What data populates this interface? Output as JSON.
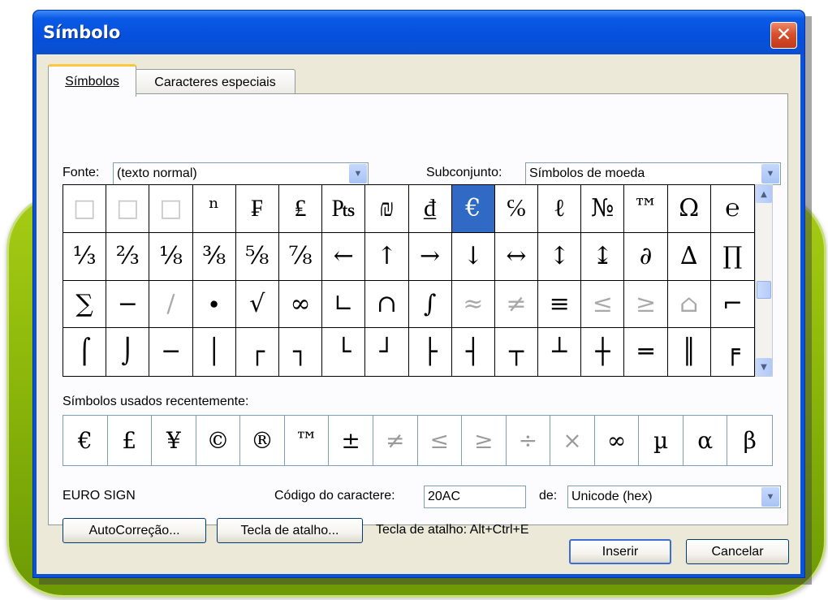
{
  "window": {
    "title": "Símbolo",
    "close_glyph": "✕"
  },
  "tabs": [
    {
      "label": "Símbolos",
      "active": true
    },
    {
      "label": "Caracteres especiais",
      "active": false
    }
  ],
  "font": {
    "label": "Fonte:",
    "value": "(texto normal)"
  },
  "subset": {
    "label": "Subconjunto:",
    "value": "Símbolos de moeda"
  },
  "symbol_grid": {
    "selected_index": 9,
    "cells": [
      "□",
      "□",
      "□",
      "ⁿ",
      "₣",
      "₤",
      "₧",
      "₪",
      "₫",
      "€",
      "℅",
      "ℓ",
      "№",
      "™",
      "Ω",
      "℮",
      "⅓",
      "⅔",
      "⅛",
      "⅜",
      "⅝",
      "⅞",
      "←",
      "↑",
      "→",
      "↓",
      "↔",
      "↕",
      "↨",
      "∂",
      "∆",
      "∏",
      "∑",
      "−",
      "∕",
      "∙",
      "√",
      "∞",
      "∟",
      "∩",
      "∫",
      "≈",
      "≠",
      "≡",
      "≤",
      "≥",
      "⌂",
      "⌐",
      "⌠",
      "⌡",
      "─",
      "│",
      "┌",
      "┐",
      "└",
      "┘",
      "├",
      "┤",
      "┬",
      "┴",
      "┼",
      "═",
      "║",
      "╒"
    ]
  },
  "recent": {
    "label": "Símbolos usados recentemente:",
    "cells": [
      "€",
      "£",
      "¥",
      "©",
      "®",
      "™",
      "±",
      "≠",
      "≤",
      "≥",
      "÷",
      "×",
      "∞",
      "µ",
      "α",
      "β"
    ]
  },
  "char_name": "EURO SIGN",
  "char_code": {
    "label": "Código do caractere:",
    "value": "20AC"
  },
  "from": {
    "label": "de:",
    "value": "Unicode (hex)"
  },
  "buttons": {
    "autocorrect": "AutoCorreção...",
    "shortcut_key": "Tecla de atalho...",
    "insert": "Inserir",
    "cancel": "Cancelar"
  },
  "shortcut_info": "Tecla de atalho: Alt+Ctrl+E",
  "colors": {
    "title_bar": "#0a5ae6",
    "selection": "#316ac5",
    "dialog_face": "#ece9d8",
    "background_accent": "#8cb70b"
  }
}
